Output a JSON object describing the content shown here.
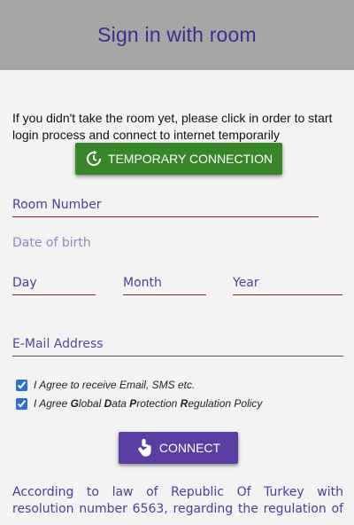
{
  "header": {
    "title": "Sign in with room"
  },
  "intro": {
    "text": "If you didn't take the room yet, please click in order to start login process and connect to internet temporarily"
  },
  "temp_button": {
    "label": "TEMPORARY CONNECTION",
    "icon": "refresh-clock-icon",
    "color": "#39862a"
  },
  "form": {
    "room_number": {
      "placeholder": "Room Number",
      "value": ""
    },
    "dob_label": "Date of birth",
    "day": {
      "placeholder": "Day",
      "value": ""
    },
    "month": {
      "placeholder": "Month",
      "value": ""
    },
    "year": {
      "placeholder": "Year",
      "value": ""
    },
    "email": {
      "placeholder": "E-Mail Address",
      "value": ""
    }
  },
  "consents": {
    "marketing": {
      "label": "I Agree to receive Email, SMS etc.",
      "checked": true
    },
    "gdpr": {
      "prefix": "I Agree ",
      "g": "G",
      "lobal": "lobal ",
      "d": "D",
      "ata": "ata ",
      "p": "P",
      "rotection": "rotection ",
      "r": "R",
      "egulation": "egulation Policy",
      "checked": true
    }
  },
  "connect_button": {
    "label": "CONNECT",
    "icon": "tap-hand-icon",
    "color": "#5a3ea2"
  },
  "legal": {
    "text": "According to law of Republic Of Turkey with resolution number 6563, regarding the regulation of"
  },
  "colors": {
    "header_bg": "#a6a6a6",
    "title": "#3b2f8c",
    "underline": "#8a2a2a"
  }
}
